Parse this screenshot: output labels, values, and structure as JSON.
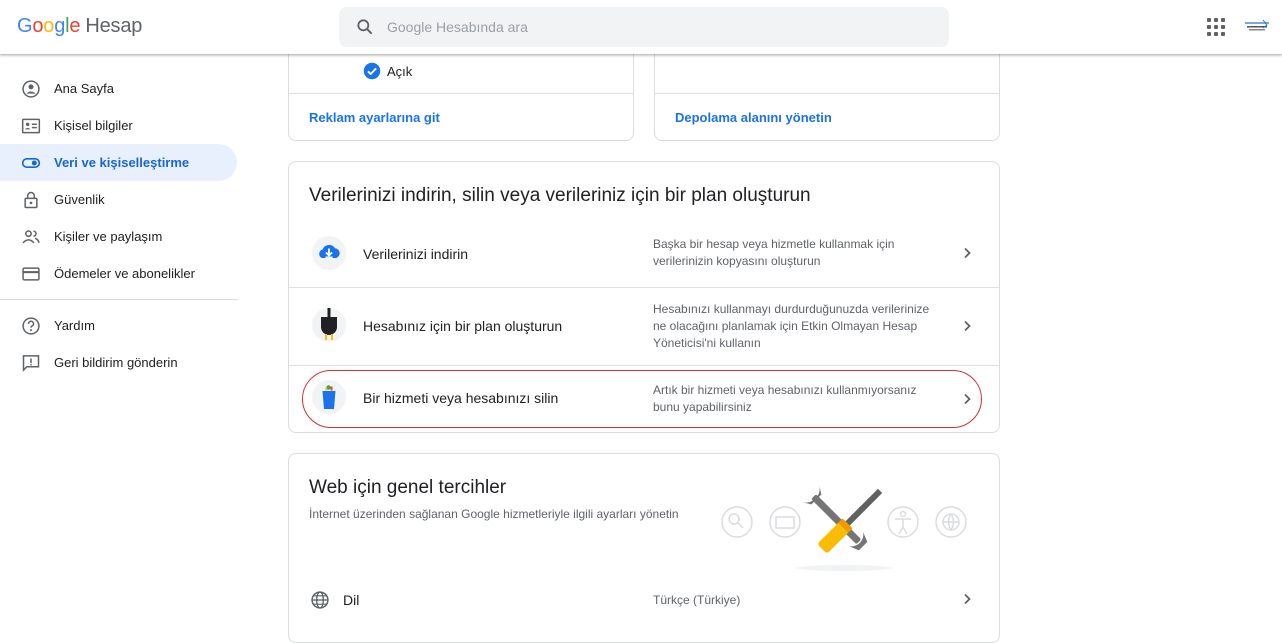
{
  "header": {
    "logo_google": "Google",
    "logo_product": "Hesap",
    "search_placeholder": "Google Hesabında ara"
  },
  "sidebar": {
    "items": [
      {
        "label": "Ana Sayfa",
        "icon": "account-circle-icon"
      },
      {
        "label": "Kişisel bilgiler",
        "icon": "id-card-icon"
      },
      {
        "label": "Veri ve kişiselleştirme",
        "icon": "toggle-icon",
        "active": true
      },
      {
        "label": "Güvenlik",
        "icon": "lock-icon"
      },
      {
        "label": "Kişiler ve paylaşım",
        "icon": "people-icon"
      },
      {
        "label": "Ödemeler ve abonelikler",
        "icon": "credit-card-icon"
      }
    ],
    "secondary": [
      {
        "label": "Yardım",
        "icon": "help-icon"
      },
      {
        "label": "Geri bildirim gönderin",
        "icon": "feedback-icon"
      }
    ]
  },
  "top_cards": {
    "ads": {
      "status": "Açık",
      "link": "Reklam ayarlarına git"
    },
    "storage": {
      "link": "Depolama alanını yönetin"
    }
  },
  "download_section": {
    "title": "Verilerinizi indirin, silin veya verileriniz için bir plan oluşturun",
    "rows": [
      {
        "title": "Verilerinizi indirin",
        "desc": "Başka bir hesap veya hizmetle kullanmak için verilerinizin kopyasını oluşturun",
        "icon": "cloud-download-icon"
      },
      {
        "title": "Hesabınız için bir plan oluşturun",
        "desc": "Hesabınızı kullanmayı durdurduğunuzda verilerinize ne olacağını planlamak için Etkin Olmayan Hesap Yöneticisi'ni kullanın",
        "icon": "plug-icon"
      },
      {
        "title": "Bir hizmeti veya hesabınızı silin",
        "desc": "Artık bir hizmeti veya hesabınızı kullanmıyorsanız bunu yapabilirsiniz",
        "icon": "trash-icon"
      }
    ]
  },
  "prefs_section": {
    "title": "Web için genel tercihler",
    "subtitle": "İnternet üzerinden sağlanan Google hizmetleriyle ilgili ayarları yönetin",
    "rows": [
      {
        "title": "Dil",
        "value": "Türkçe (Türkiye)",
        "icon": "globe-icon"
      }
    ]
  },
  "colors": {
    "accent": "#1a73e8",
    "active_bg": "#e8f0fe",
    "highlight_circle": "#d32f2f"
  }
}
